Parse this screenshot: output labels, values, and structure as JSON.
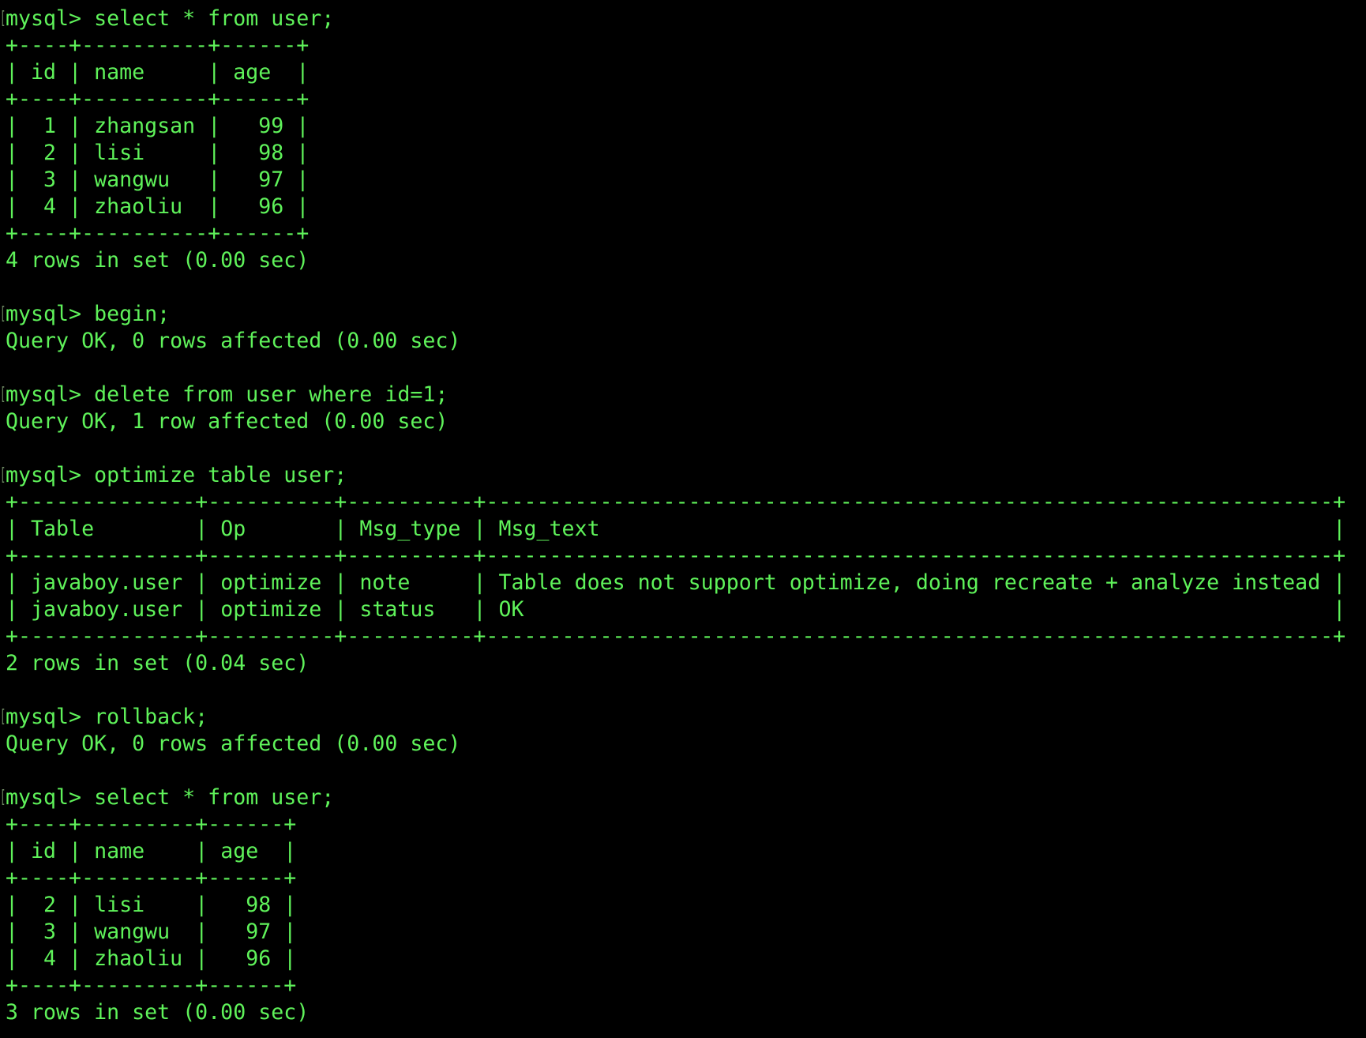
{
  "terminal": {
    "prompt": "mysql> ",
    "colors": {
      "background": "#000000",
      "text": "#5ff25a",
      "bracket_marker": "#6f8a63"
    },
    "session": [
      {
        "command": "select * from user;",
        "table": {
          "columns": [
            "id",
            "name",
            "age"
          ],
          "align": [
            "right",
            "left",
            "right"
          ],
          "rows": [
            [
              "1",
              "zhangsan",
              "99"
            ],
            [
              "2",
              "lisi",
              "98"
            ],
            [
              "3",
              "wangwu",
              "97"
            ],
            [
              "4",
              "zhaoliu",
              "96"
            ]
          ],
          "min_widths": [
            2,
            8,
            4
          ]
        },
        "result": "4 rows in set (0.00 sec)"
      },
      {
        "command": "begin;",
        "result": "Query OK, 0 rows affected (0.00 sec)"
      },
      {
        "command": "delete from user where id=1;",
        "result": "Query OK, 1 row affected (0.00 sec)"
      },
      {
        "command": "optimize table user;",
        "table": {
          "columns": [
            "Table",
            "Op",
            "Msg_type",
            "Msg_text"
          ],
          "align": [
            "left",
            "left",
            "left",
            "left"
          ],
          "rows": [
            [
              "javaboy.user",
              "optimize",
              "note",
              "Table does not support optimize, doing recreate + analyze instead"
            ],
            [
              "javaboy.user",
              "optimize",
              "status",
              "OK"
            ]
          ],
          "min_widths": [
            0,
            0,
            0,
            0
          ]
        },
        "result": "2 rows in set (0.04 sec)"
      },
      {
        "command": "rollback;",
        "result": "Query OK, 0 rows affected (0.00 sec)"
      },
      {
        "command": "select * from user;",
        "table": {
          "columns": [
            "id",
            "name",
            "age"
          ],
          "align": [
            "right",
            "left",
            "right"
          ],
          "rows": [
            [
              "2",
              "lisi",
              "98"
            ],
            [
              "3",
              "wangwu",
              "97"
            ],
            [
              "4",
              "zhaoliu",
              "96"
            ]
          ],
          "min_widths": [
            2,
            7,
            4
          ]
        },
        "result": "3 rows in set (0.00 sec)"
      }
    ]
  }
}
